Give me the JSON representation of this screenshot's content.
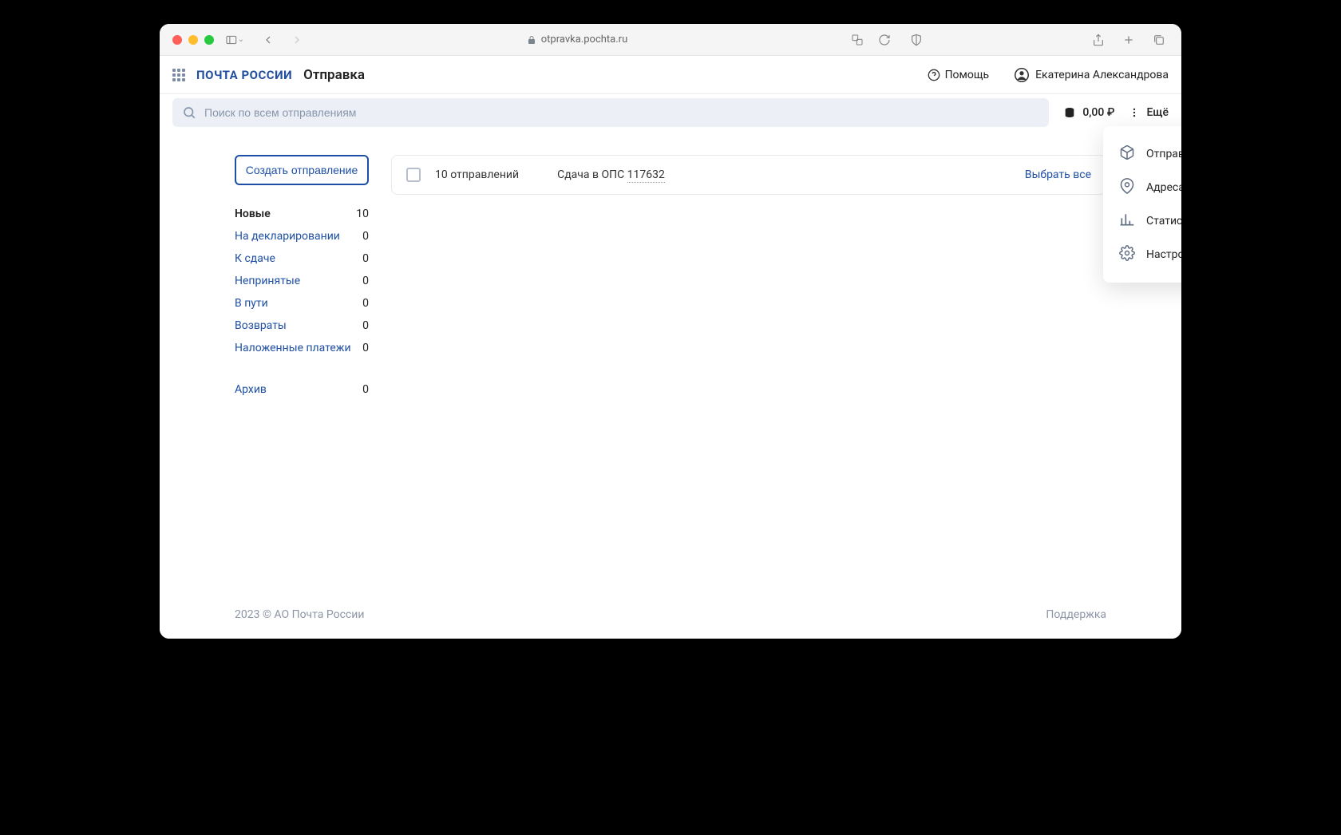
{
  "browser": {
    "url": "otpravka.pochta.ru"
  },
  "header": {
    "logo": "ПОЧТА РОССИИ",
    "app_title": "Отправка",
    "help": "Помощь",
    "user_name": "Екатерина Александрова"
  },
  "search": {
    "placeholder": "Поиск по всем отправлениям",
    "balance": "0,00 ₽",
    "more_label": "Ещё"
  },
  "sidebar": {
    "create_button": "Создать отправление",
    "items": [
      {
        "label": "Новые",
        "count": "10",
        "active": true
      },
      {
        "label": "На декларировании",
        "count": "0"
      },
      {
        "label": "К сдаче",
        "count": "0"
      },
      {
        "label": "Непринятые",
        "count": "0"
      },
      {
        "label": "В пути",
        "count": "0"
      },
      {
        "label": "Возвраты",
        "count": "0"
      },
      {
        "label": "Наложенные платежи",
        "count": "0"
      }
    ],
    "archive": {
      "label": "Архив",
      "count": "0"
    }
  },
  "batch": {
    "count_label": "10 отправлений",
    "deposit_prefix": "Сдача в ОПС ",
    "deposit_code": "117632",
    "select_all": "Выбрать все"
  },
  "dropdown": {
    "items": [
      {
        "label": "Отправления"
      },
      {
        "label": "Адреса"
      },
      {
        "label": "Статистика"
      },
      {
        "label": "Настройки"
      }
    ]
  },
  "footer": {
    "copyright": "2023 © АО Почта России",
    "support": "Поддержка"
  }
}
